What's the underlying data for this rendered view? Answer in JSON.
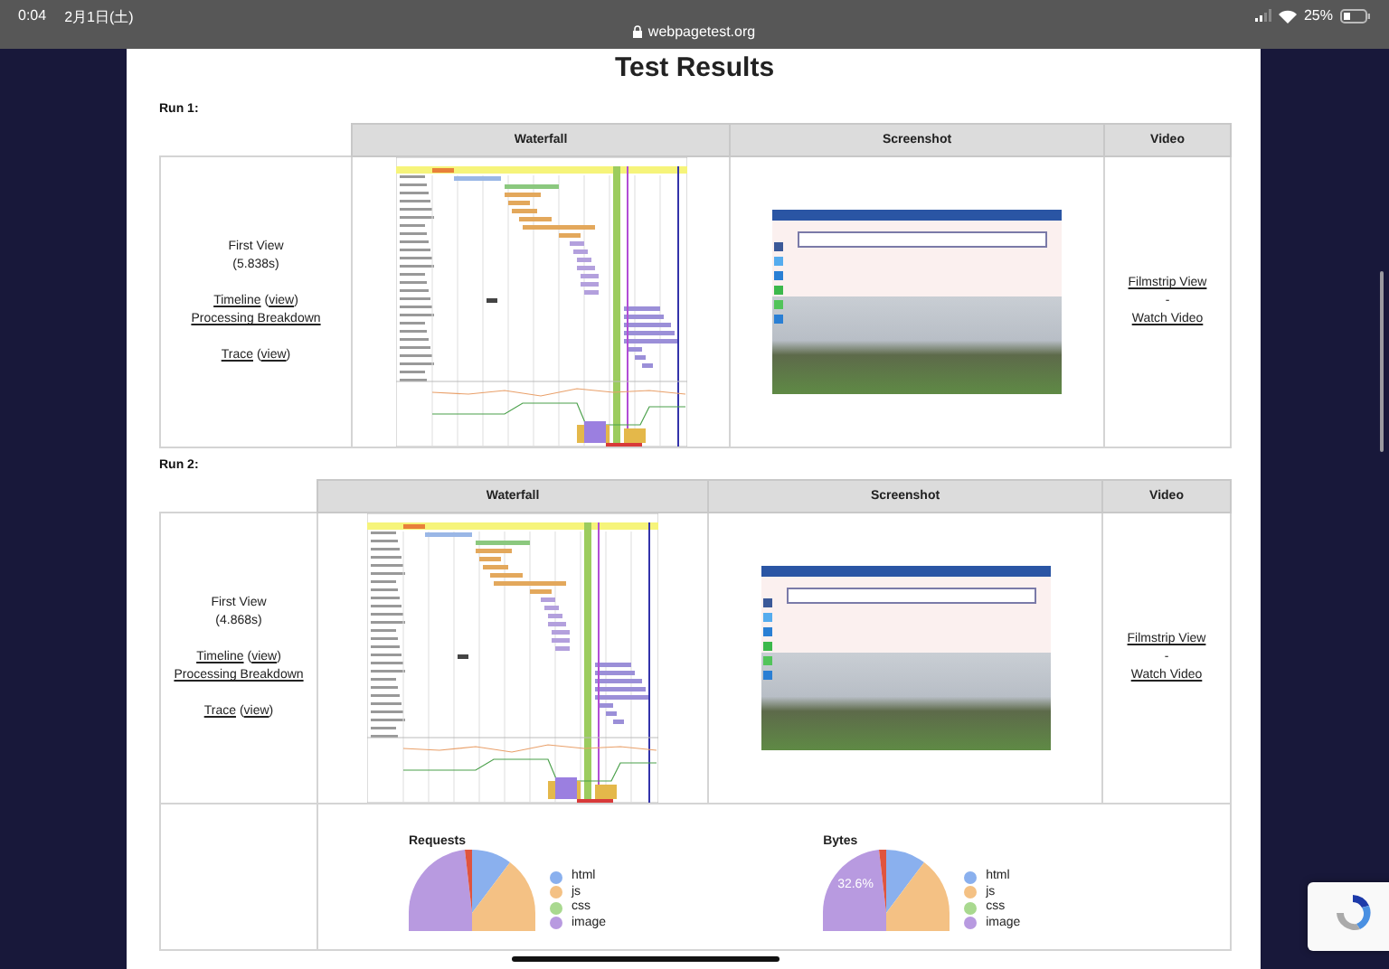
{
  "status_bar": {
    "time": "0:04",
    "date": "2月1日(土)",
    "url": "webpagetest.org",
    "battery": "25%"
  },
  "title": "Test Results",
  "runs": [
    {
      "label": "Run 1:",
      "columns": [
        "Waterfall",
        "Screenshot",
        "Video"
      ],
      "view": "First View",
      "load_time": "(5.838s)",
      "timeline": {
        "label": "Timeline",
        "open": "(",
        "view": "view",
        "close": ")"
      },
      "breakdown": "Processing Breakdown",
      "trace": {
        "label": "Trace",
        "open": "(",
        "view": "view",
        "close": ")"
      },
      "video": {
        "filmstrip": "Filmstrip View",
        "separator": "-",
        "watch": "Watch Video"
      }
    },
    {
      "label": "Run 2:",
      "columns": [
        "Waterfall",
        "Screenshot",
        "Video"
      ],
      "view": "First View",
      "load_time": "(4.868s)",
      "timeline": {
        "label": "Timeline",
        "open": "(",
        "view": "view",
        "close": ")"
      },
      "breakdown": "Processing Breakdown",
      "trace": {
        "label": "Trace",
        "open": "(",
        "view": "view",
        "close": ")"
      },
      "video": {
        "filmstrip": "Filmstrip View",
        "separator": "-",
        "watch": "Watch Video"
      },
      "charts": [
        {
          "title": "Requests",
          "legend": [
            {
              "label": "html",
              "color": "#8ab0ee"
            },
            {
              "label": "js",
              "color": "#f4c184"
            },
            {
              "label": "css",
              "color": "#a9d98f"
            },
            {
              "label": "image",
              "color": "#b89ae0"
            }
          ]
        },
        {
          "title": "Bytes",
          "slice_label": "32.6%",
          "legend": [
            {
              "label": "html",
              "color": "#8ab0ee"
            },
            {
              "label": "js",
              "color": "#f4c184"
            },
            {
              "label": "css",
              "color": "#a9d98f"
            },
            {
              "label": "image",
              "color": "#b89ae0"
            }
          ]
        }
      ]
    }
  ]
}
